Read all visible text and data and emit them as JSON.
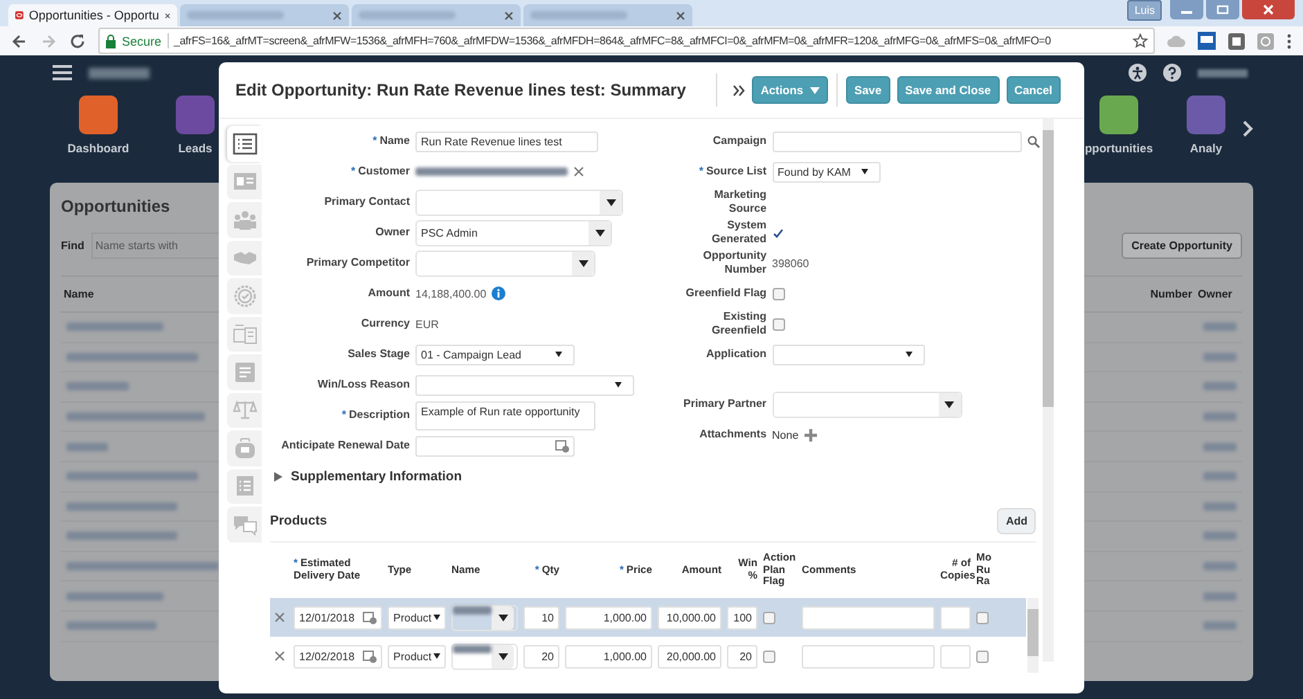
{
  "browser": {
    "tabs": [
      {
        "title": "Opportunities - Opportu",
        "selected": true
      },
      {
        "selected": false
      },
      {
        "selected": false
      },
      {
        "selected": false
      }
    ],
    "profile": "Luis",
    "secure_label": "Secure",
    "url": "_afrFS=16&_afrMT=screen&_afrMFW=1536&_afrMFH=760&_afrMFDW=1536&_afrMFDH=864&_afrMFC=8&_afrMFCI=0&_afrMFM=0&_afrMFR=120&_afrMFG=0&_afrMFS=0&_afrMFO=0"
  },
  "app": {
    "nav": [
      {
        "label": "Dashboard",
        "color": "#e0622a"
      },
      {
        "label": "Leads",
        "color": "#6b4aa0"
      },
      {
        "label": "pportunities",
        "color": "#6aa84f"
      },
      {
        "label": "Analy",
        "color": "#6b5aa8"
      }
    ]
  },
  "list_panel": {
    "title": "Opportunities",
    "find_label": "Find",
    "find_placeholder": "Name starts with",
    "create_button": "Create Opportunity",
    "columns": [
      "Name",
      "Number",
      "Owner"
    ]
  },
  "modal": {
    "title": "Edit Opportunity: Run Rate Revenue lines test: Summary",
    "actions": [
      {
        "label": "Actions",
        "kind": "menu"
      },
      {
        "label": "Save",
        "kind": "button"
      },
      {
        "label": "Save and Close",
        "kind": "button"
      },
      {
        "label": "Cancel",
        "kind": "button"
      }
    ],
    "side_tabs": [
      {
        "selected": true
      },
      {
        "selected": false
      },
      {
        "selected": false
      },
      {
        "selected": false
      },
      {
        "selected": false
      },
      {
        "selected": false
      },
      {
        "selected": false
      },
      {
        "selected": false
      },
      {
        "selected": false
      },
      {
        "selected": false
      },
      {
        "selected": false
      }
    ],
    "left_fields": [
      {
        "label": "Name",
        "mark": "*",
        "kind": "input",
        "value": "Run Rate Revenue lines test"
      },
      {
        "label": "Customer",
        "mark": "*",
        "kind": "blurred"
      },
      {
        "label": "Primary Contact",
        "kind": "combo"
      },
      {
        "label": "Owner",
        "kind": "combo",
        "value": "PSC Admin"
      },
      {
        "label": "Primary Competitor",
        "kind": "combo"
      },
      {
        "label": "Amount",
        "kind": "amount",
        "value": "14,188,400.00"
      },
      {
        "label": "Currency",
        "kind": "readonly",
        "value": "EUR"
      },
      {
        "label": "Sales Stage",
        "kind": "select",
        "value": "01 - Campaign Lead"
      },
      {
        "label": "Win/Loss Reason",
        "kind": "select"
      },
      {
        "label": "Description",
        "mark": "*",
        "kind": "textarea",
        "value": "Example of Run rate opportunity"
      },
      {
        "label": "Anticipate Renewal Date",
        "kind": "date"
      }
    ],
    "right_fields": [
      {
        "label": "Campaign",
        "kind": "search"
      },
      {
        "label": "Source List",
        "mark": "*",
        "kind": "select",
        "value": "Found by KAM"
      },
      {
        "label": "Marketing Source",
        "kind": "empty"
      },
      {
        "label": "System Generated",
        "kind": "check_display",
        "checked": true
      },
      {
        "label": "Opportunity Number",
        "kind": "readonly",
        "value": "398060"
      },
      {
        "label": "Greenfield Flag",
        "kind": "checkbox",
        "checked": false
      },
      {
        "label": "Existing Greenfield",
        "kind": "checkbox",
        "checked": false
      },
      {
        "label": "Application",
        "kind": "select"
      },
      {
        "label": "Primary Partner",
        "kind": "combo"
      },
      {
        "label": "Attachments",
        "kind": "attachments",
        "value": "None"
      }
    ],
    "supplementary": {
      "label": "Supplementary Information",
      "expanded": false
    },
    "products": {
      "title": "Products",
      "add_button": "Add",
      "columns": [
        {
          "label": "Estimated Delivery Date",
          "mark": "*"
        },
        {
          "label": "Type"
        },
        {
          "label": "Name"
        },
        {
          "label": "Qty",
          "mark": "*"
        },
        {
          "label": "Price",
          "mark": "*"
        },
        {
          "label": "Amount"
        },
        {
          "label": "Win %"
        },
        {
          "label": "Action Plan Flag"
        },
        {
          "label": "Comments"
        },
        {
          "label": "# of Copies"
        },
        {
          "label": "Mo Ru Ra"
        }
      ],
      "rows": [
        {
          "selected": true,
          "date": "12/01/2018",
          "type": "Product",
          "qty": "10",
          "price": "1,000.00",
          "amount": "10,000.00",
          "win": "100",
          "action_plan": false,
          "multi": false
        },
        {
          "selected": false,
          "date": "12/02/2018",
          "type": "Product",
          "qty": "20",
          "price": "1,000.00",
          "amount": "20,000.00",
          "win": "20",
          "action_plan": false,
          "multi": false
        }
      ]
    }
  }
}
